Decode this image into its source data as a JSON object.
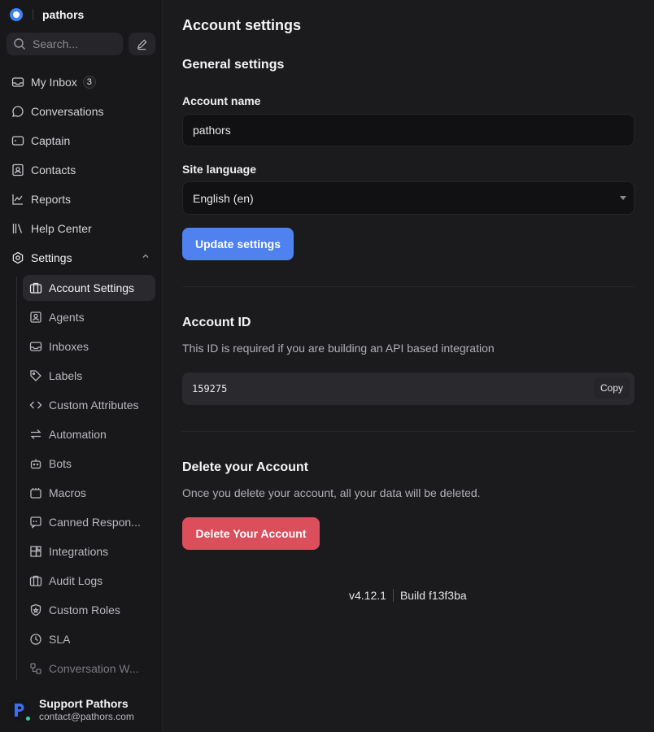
{
  "brand": {
    "name": "pathors"
  },
  "search": {
    "placeholder": "Search..."
  },
  "sidebar": {
    "items": [
      {
        "label": "My Inbox",
        "badge": "3",
        "icon": "inbox-icon"
      },
      {
        "label": "Conversations",
        "icon": "chat-bubble-icon"
      },
      {
        "label": "Captain",
        "icon": "captain-icon"
      },
      {
        "label": "Contacts",
        "icon": "contact-card-icon"
      },
      {
        "label": "Reports",
        "icon": "chart-line-icon"
      },
      {
        "label": "Help Center",
        "icon": "library-icon"
      },
      {
        "label": "Settings",
        "icon": "gear-icon"
      }
    ],
    "settings_items": [
      {
        "label": "Account Settings",
        "icon": "briefcase-icon"
      },
      {
        "label": "Agents",
        "icon": "user-square-icon"
      },
      {
        "label": "Inboxes",
        "icon": "inbox-icon"
      },
      {
        "label": "Labels",
        "icon": "tag-icon"
      },
      {
        "label": "Custom Attributes",
        "icon": "code-icon"
      },
      {
        "label": "Automation",
        "icon": "arrows-swap-icon"
      },
      {
        "label": "Bots",
        "icon": "bot-icon"
      },
      {
        "label": "Macros",
        "icon": "macro-icon"
      },
      {
        "label": "Canned Respon...",
        "icon": "canned-response-icon"
      },
      {
        "label": "Integrations",
        "icon": "puzzle-icon"
      },
      {
        "label": "Audit Logs",
        "icon": "briefcase-icon"
      },
      {
        "label": "Custom Roles",
        "icon": "shield-icon"
      },
      {
        "label": "SLA",
        "icon": "clock-icon"
      },
      {
        "label": "Conversation W...",
        "icon": "workflow-icon"
      }
    ]
  },
  "user": {
    "name": "Support Pathors",
    "email": "contact@pathors.com"
  },
  "main": {
    "title": "Account settings",
    "general": {
      "heading": "General settings",
      "account_name_label": "Account name",
      "account_name_value": "pathors",
      "site_language_label": "Site language",
      "site_language_value": "English (en)",
      "update_button": "Update settings"
    },
    "account_id": {
      "heading": "Account ID",
      "description": "This ID is required if you are building an API based integration",
      "value": "159275",
      "copy_button": "Copy"
    },
    "delete": {
      "heading": "Delete your Account",
      "description": "Once you delete your account, all your data will be deleted.",
      "button": "Delete Your Account"
    },
    "footer": {
      "version": "v4.12.1",
      "build": "Build f13f3ba"
    }
  },
  "colors": {
    "primary": "#4f82ee",
    "danger": "#db4f5c",
    "online": "#34d399"
  }
}
